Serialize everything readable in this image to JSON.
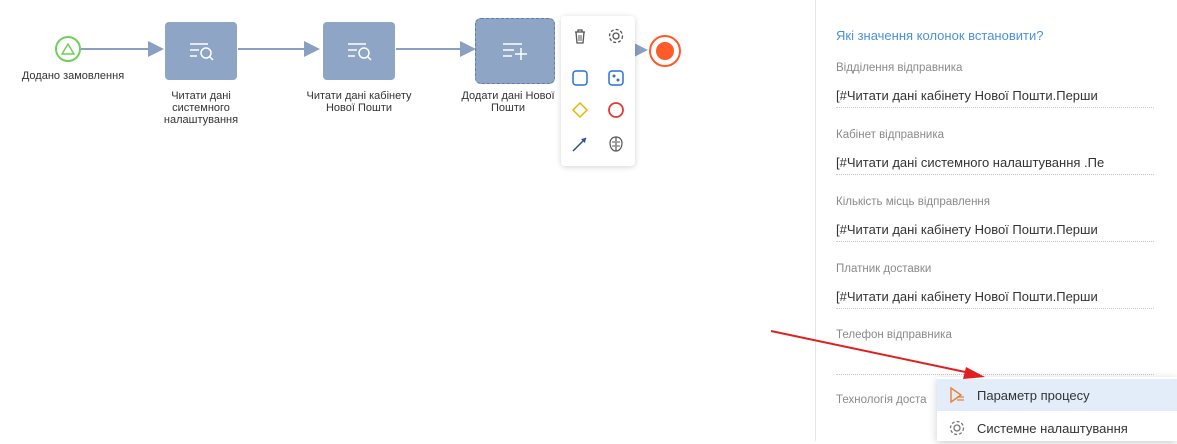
{
  "diagram": {
    "start_label": "Додано замовлення",
    "tasks": [
      {
        "label": "Читати дані системного налаштування"
      },
      {
        "label": "Читати дані кабінету Нової Пошти"
      },
      {
        "label": "Додати дані Нової Пошти"
      }
    ],
    "colors": {
      "task": "#8fa5c6",
      "start": "#6fcf5b",
      "end": "#ff5a2a",
      "link": "#8aa0c2"
    }
  },
  "toolbar": {
    "icons": [
      "trash-icon",
      "gear-icon",
      "task-square-icon",
      "image-task-icon",
      "gateway-diamond-icon",
      "end-event-circle-icon",
      "connector-arrow-icon",
      "ml-brain-icon"
    ]
  },
  "panel": {
    "title": "Які значення колонок встановити?",
    "fields": [
      {
        "label": "Відділення відправника",
        "value": "[#Читати дані кабінету Нової Пошти.Перши"
      },
      {
        "label": "Кабінет відправника",
        "value": "[#Читати дані системного налаштування .Пе"
      },
      {
        "label": "Кількість місць відправлення",
        "value": "[#Читати дані кабінету Нової Пошти.Перши"
      },
      {
        "label": "Платник доставки",
        "value": "[#Читати дані кабінету Нової Пошти.Перши"
      },
      {
        "label": "Телефон відправника",
        "value": ""
      },
      {
        "label": "Технологія доста",
        "value": ""
      }
    ]
  },
  "dropdown": {
    "items": [
      {
        "label": "Параметр процесу",
        "icon": "process-parameter-icon"
      },
      {
        "label": "Системне налаштування",
        "icon": "gear-icon"
      }
    ]
  },
  "annotation": {
    "color": "#e02020"
  }
}
